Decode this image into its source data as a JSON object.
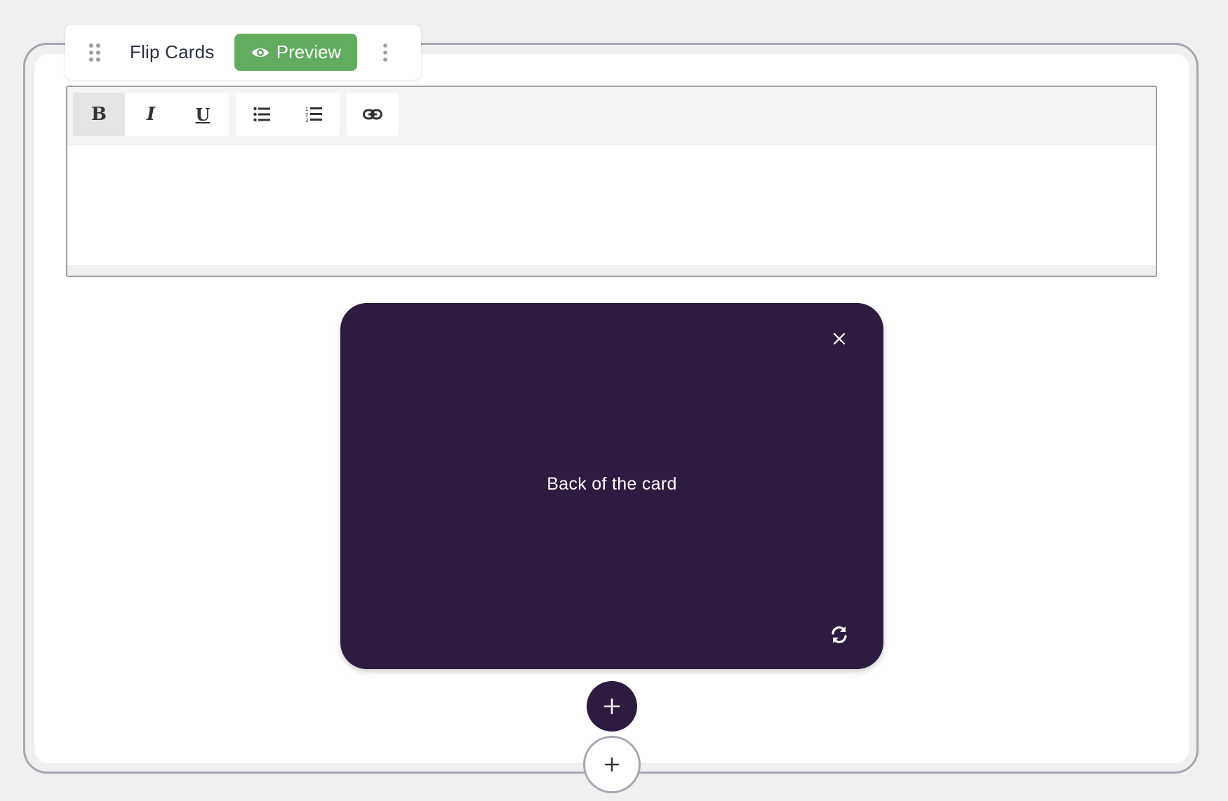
{
  "block": {
    "title": "Flip Cards",
    "preview_label": "Preview",
    "drag_icon": "drag-handle-icon",
    "more_icon": "vertical-ellipsis-icon"
  },
  "editor": {
    "toolbar": [
      {
        "name": "bold",
        "glyph": "B",
        "active": true
      },
      {
        "name": "italic",
        "glyph": "I",
        "active": false
      },
      {
        "name": "underline",
        "glyph": "U",
        "active": false
      },
      {
        "name": "bulleted-list",
        "icon": "bulleted-list-icon",
        "active": false
      },
      {
        "name": "numbered-list",
        "icon": "numbered-list-icon",
        "active": false
      },
      {
        "name": "link",
        "icon": "link-icon",
        "active": false
      }
    ],
    "content": ""
  },
  "card": {
    "text": "Back of the card",
    "background": "#2d1b40",
    "close_icon": "close-icon",
    "flip_icon": "flip-refresh-icon"
  },
  "colors": {
    "accent_green": "#62ac5f",
    "card_purple": "#2d1b40",
    "frame_border": "#a3a8b1"
  }
}
